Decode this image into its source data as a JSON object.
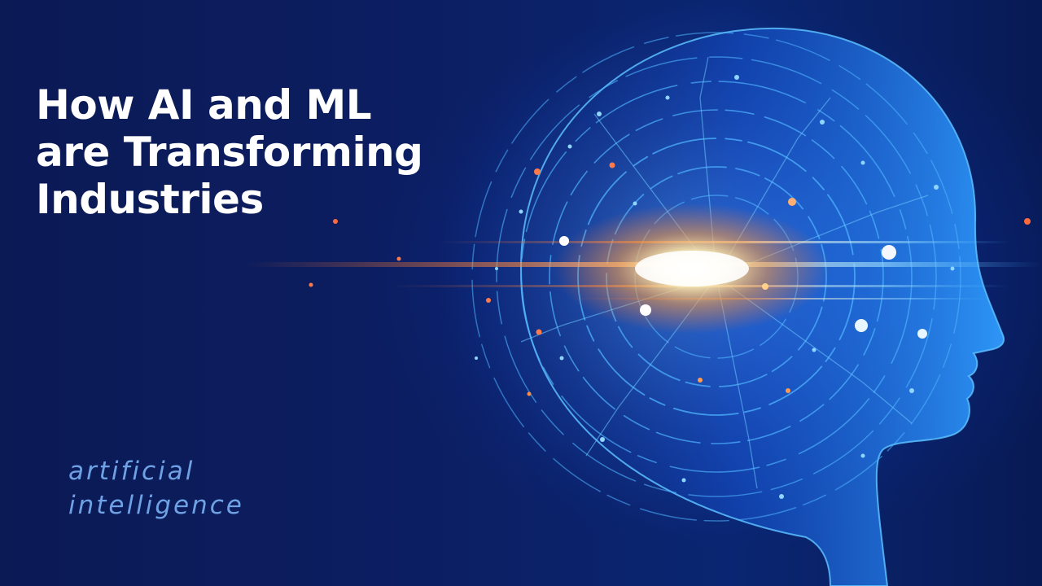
{
  "headline": {
    "line1": "How AI and ML",
    "line2": "are Transforming",
    "line3": "Industries"
  },
  "tagline": {
    "line1": "artificial",
    "line2": "intelligence"
  },
  "illustration": {
    "subject": "glowing-digital-human-head-profile-icon",
    "colors": {
      "background": "#0b1a55",
      "circuit": "#4fb4ff",
      "glow_core": "#fff4d0",
      "flare": "#ff8a3d",
      "text": "#ffffff",
      "tagline": "#6fa2e4"
    }
  }
}
